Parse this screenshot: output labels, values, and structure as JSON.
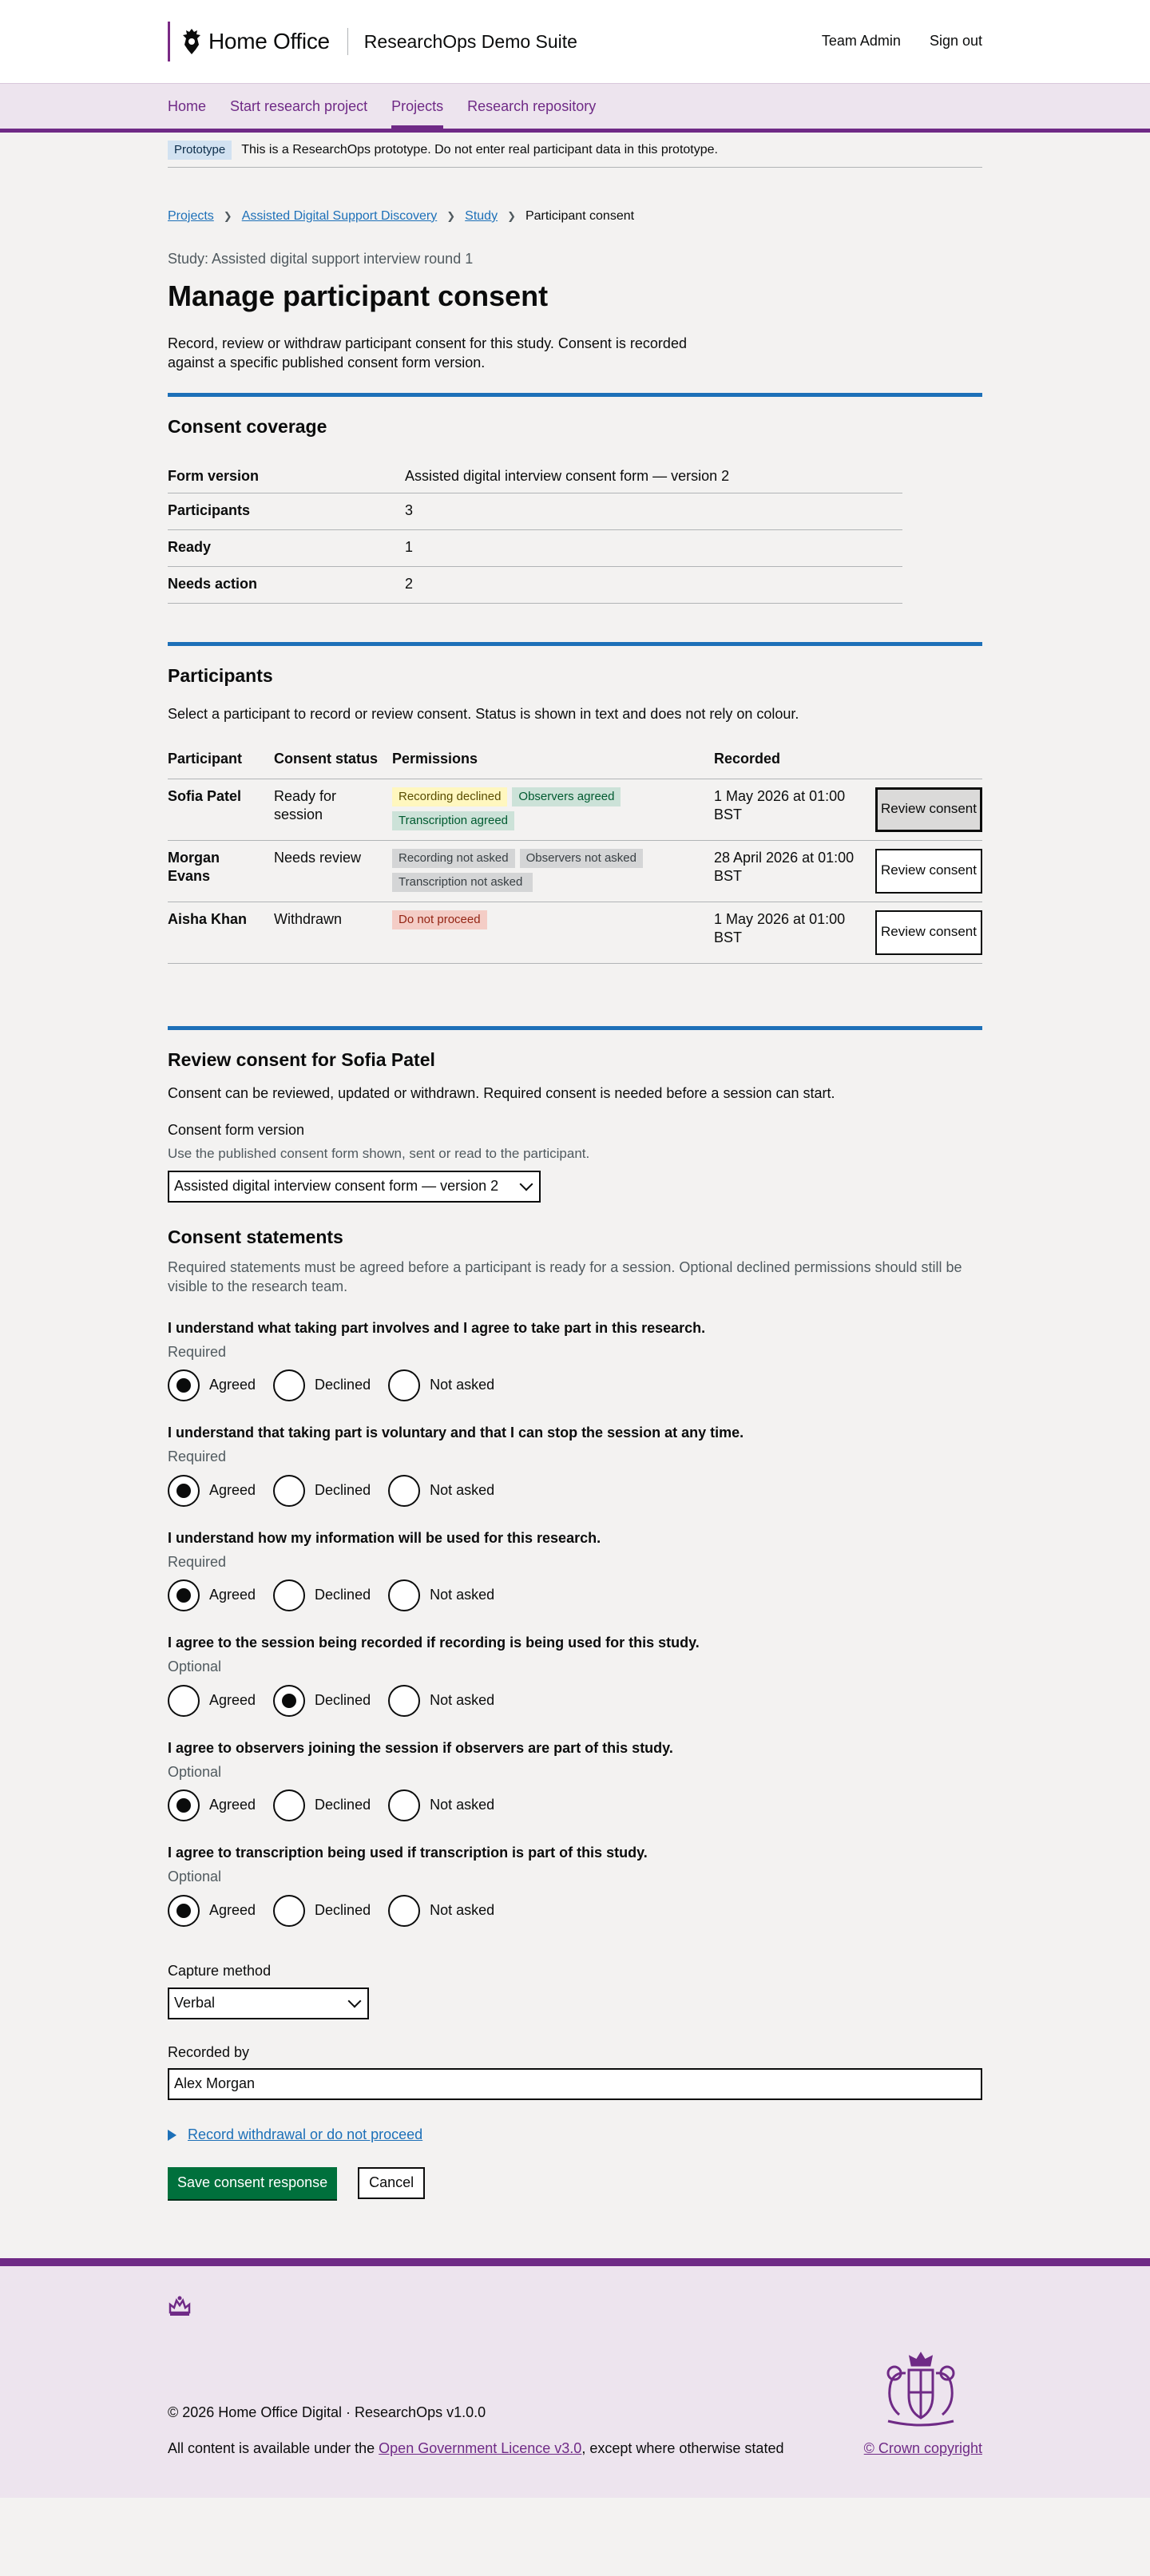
{
  "header": {
    "logo_text": "Home Office",
    "service_name": "ResearchOps Demo Suite",
    "links": [
      "Team Admin",
      "Sign out"
    ]
  },
  "nav": {
    "items": [
      "Home",
      "Start research project",
      "Projects",
      "Research repository"
    ],
    "active": "Projects"
  },
  "phase": {
    "tag": "Prototype",
    "text": "This is a ResearchOps prototype. Do not enter real participant data in this prototype."
  },
  "breadcrumb": {
    "items": [
      "Projects",
      "Assisted Digital Support Discovery",
      "Study"
    ],
    "current": "Participant consent"
  },
  "page": {
    "caption": "Study: Assisted digital support interview round 1",
    "title": "Manage participant consent",
    "lead": "Record, review or withdraw participant consent for this study. Consent is recorded against a specific published consent form version."
  },
  "coverage": {
    "heading": "Consent coverage",
    "rows": [
      {
        "key": "Form version",
        "value": "Assisted digital interview consent form — version 2"
      },
      {
        "key": "Participants",
        "value": "3"
      },
      {
        "key": "Ready",
        "value": "1"
      },
      {
        "key": "Needs action",
        "value": "2"
      }
    ]
  },
  "participants": {
    "heading": "Participants",
    "intro": "Select a participant to record or review consent. Status is shown in text and does not rely on colour.",
    "columns": [
      "Participant",
      "Consent status",
      "Permissions",
      "Recorded"
    ],
    "rows": [
      {
        "name": "Sofia Patel",
        "status": "Ready for session",
        "tags": [
          {
            "label": "Recording declined",
            "color": "#fff7bf"
          },
          {
            "label": "Observers agreed",
            "color": "#cce2d8"
          },
          {
            "label": "Transcription agreed",
            "color": "#cce2d8"
          }
        ],
        "recorded": "1 May 2026 at 01:00 BST",
        "action": "Review consent"
      },
      {
        "name": "Morgan Evans",
        "status": "Needs review",
        "tags": [
          {
            "label": "Recording not asked",
            "color": "#d4d5d6"
          },
          {
            "label": "Observers not asked",
            "color": "#d4d5d6"
          },
          {
            "label": "Transcription not asked",
            "color": "#d4d5d6"
          }
        ],
        "recorded": "28 April 2026 at 01:00 BST",
        "action": "Review consent"
      },
      {
        "name": "Aisha Khan",
        "status": "Withdrawn",
        "tags": [
          {
            "label": "Do not proceed",
            "color": "#f4cdc6"
          }
        ],
        "recorded": "1 May 2026 at 01:00 BST",
        "action": "Review consent"
      }
    ]
  },
  "review": {
    "heading": "Review consent for Sofia Patel",
    "intro": "Consent can be reviewed, updated or withdrawn. Required consent is needed before a session can start.",
    "form_version_label": "Consent form version",
    "form_version_hint": "Use the published consent form shown, sent or read to the participant.",
    "form_version_value": "Assisted digital interview consent form — version 2",
    "statements_heading": "Consent statements",
    "statements_hint": "Required statements must be agreed before a participant is ready for a session. Optional declined permissions should still be visible to the research team.",
    "options": [
      "Agreed",
      "Declined",
      "Not asked"
    ],
    "statements": [
      {
        "text": "I understand what taking part involves and I agree to take part in this research.",
        "requirement": "Required",
        "selected": "Agreed"
      },
      {
        "text": "I understand that taking part is voluntary and that I can stop the session at any time.",
        "requirement": "Required",
        "selected": "Agreed"
      },
      {
        "text": "I understand how my information will be used for this research.",
        "requirement": "Required",
        "selected": "Agreed"
      },
      {
        "text": "I agree to the session being recorded if recording is being used for this study.",
        "requirement": "Optional",
        "selected": "Declined"
      },
      {
        "text": "I agree to observers joining the session if observers are part of this study.",
        "requirement": "Optional",
        "selected": "Agreed"
      },
      {
        "text": "I agree to transcription being used if transcription is part of this study.",
        "requirement": "Optional",
        "selected": "Agreed"
      }
    ],
    "capture_label": "Capture method",
    "capture_value": "Verbal",
    "recorded_by_label": "Recorded by",
    "recorded_by_value": "Alex Morgan",
    "details_link": "Record withdrawal or do not proceed",
    "save_label": "Save consent response",
    "cancel_label": "Cancel"
  },
  "footer": {
    "copyright": "© 2026 Home Office Digital · ResearchOps v1.0.0",
    "licence_prefix": "All content is available under the ",
    "licence_link": "Open Government Licence v3.0",
    "licence_suffix": ", except where otherwise stated",
    "crown_link": "© Crown copyright"
  },
  "colors": {
    "brand": "#6f2a86",
    "link": "#1d70b8",
    "primary_button": "#00703c",
    "section_rule": "#1d70b8"
  }
}
